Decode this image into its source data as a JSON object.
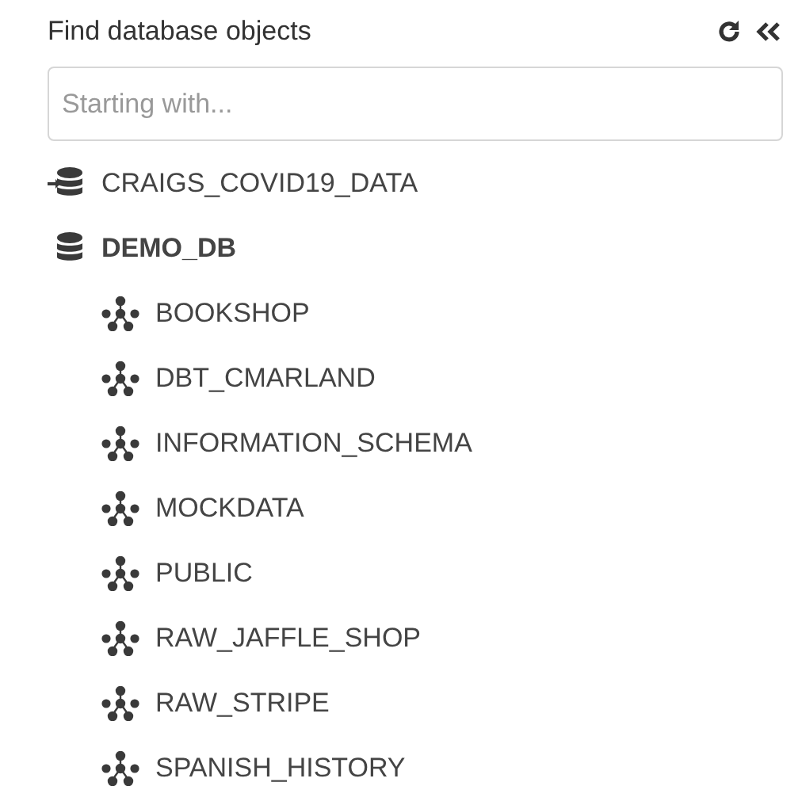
{
  "panel": {
    "title": "Find database objects"
  },
  "search": {
    "placeholder": "Starting with..."
  },
  "tree": [
    {
      "label": "CRAIGS_COVID19_DATA",
      "kind": "shared",
      "expanded": false
    },
    {
      "label": "DEMO_DB",
      "kind": "database",
      "expanded": true,
      "children": [
        {
          "label": "BOOKSHOP",
          "kind": "schema"
        },
        {
          "label": "DBT_CMARLAND",
          "kind": "schema"
        },
        {
          "label": "INFORMATION_SCHEMA",
          "kind": "schema"
        },
        {
          "label": "MOCKDATA",
          "kind": "schema"
        },
        {
          "label": "PUBLIC",
          "kind": "schema"
        },
        {
          "label": "RAW_JAFFLE_SHOP",
          "kind": "schema"
        },
        {
          "label": "RAW_STRIPE",
          "kind": "schema"
        },
        {
          "label": "SPANISH_HISTORY",
          "kind": "schema"
        }
      ]
    }
  ]
}
